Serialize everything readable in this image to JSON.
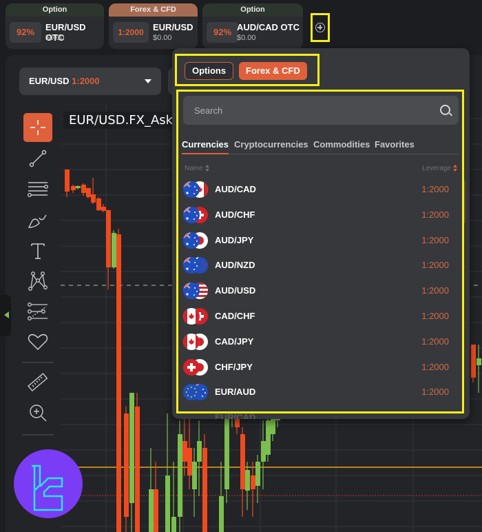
{
  "top_tabs": [
    {
      "category": "Option",
      "badge": "92%",
      "pair": "EUR/USD OTC",
      "balance": "$0.00"
    },
    {
      "category": "Forex & CFD",
      "badge": "1:2000",
      "pair": "EUR/USD",
      "balance": "$0.00"
    },
    {
      "category": "Option",
      "badge": "92%",
      "pair": "AUD/CAD OTC",
      "balance": "$0.00"
    }
  ],
  "asset_selector": {
    "pair": "EUR/USD",
    "leverage": "1:2000"
  },
  "chart": {
    "symbol": "EUR/USD.FX_Ask"
  },
  "toolbar": {
    "tools": [
      "crosshair",
      "trend-line",
      "horizontal-lines",
      "brush",
      "text",
      "pattern",
      "fib",
      "favorites",
      "ruler",
      "zoom-in"
    ]
  },
  "panel": {
    "mode_tabs": [
      {
        "label": "Options",
        "active": false
      },
      {
        "label": "Forex & CFD",
        "active": true
      }
    ],
    "search": {
      "placeholder": "Search",
      "value": ""
    },
    "category_tabs": [
      {
        "label": "Currencies",
        "active": true
      },
      {
        "label": "Cryptocurrencies",
        "active": false
      },
      {
        "label": "Commodities",
        "active": false
      },
      {
        "label": "Favorites",
        "active": false
      }
    ],
    "columns": {
      "name": "Name",
      "leverage": "Leverage"
    },
    "rows": [
      {
        "name": "AUD/CAD",
        "leverage": "1:2000",
        "flags": [
          "aud",
          "cad"
        ]
      },
      {
        "name": "AUD/CHF",
        "leverage": "1:2000",
        "flags": [
          "aud",
          "chf"
        ]
      },
      {
        "name": "AUD/JPY",
        "leverage": "1:2000",
        "flags": [
          "aud",
          "jpy"
        ]
      },
      {
        "name": "AUD/NZD",
        "leverage": "1:2000",
        "flags": [
          "aud",
          "nzd"
        ]
      },
      {
        "name": "AUD/USD",
        "leverage": "1:2000",
        "flags": [
          "aud",
          "usd"
        ]
      },
      {
        "name": "CAD/CHF",
        "leverage": "1:2000",
        "flags": [
          "cad",
          "chf"
        ]
      },
      {
        "name": "CAD/JPY",
        "leverage": "1:2000",
        "flags": [
          "cad",
          "jpy"
        ]
      },
      {
        "name": "CHF/JPY",
        "leverage": "1:2000",
        "flags": [
          "chf",
          "jpy"
        ]
      },
      {
        "name": "EUR/AUD",
        "leverage": "1:2000",
        "flags": [
          "eur",
          "aud"
        ]
      }
    ],
    "partial_row": "EUR/CAD"
  },
  "colors": {
    "accent": "#e0603b",
    "up": "#7bbf4e",
    "down": "#f04a1e",
    "highlight": "#f5ef1a",
    "price_line": "#e8a317"
  }
}
